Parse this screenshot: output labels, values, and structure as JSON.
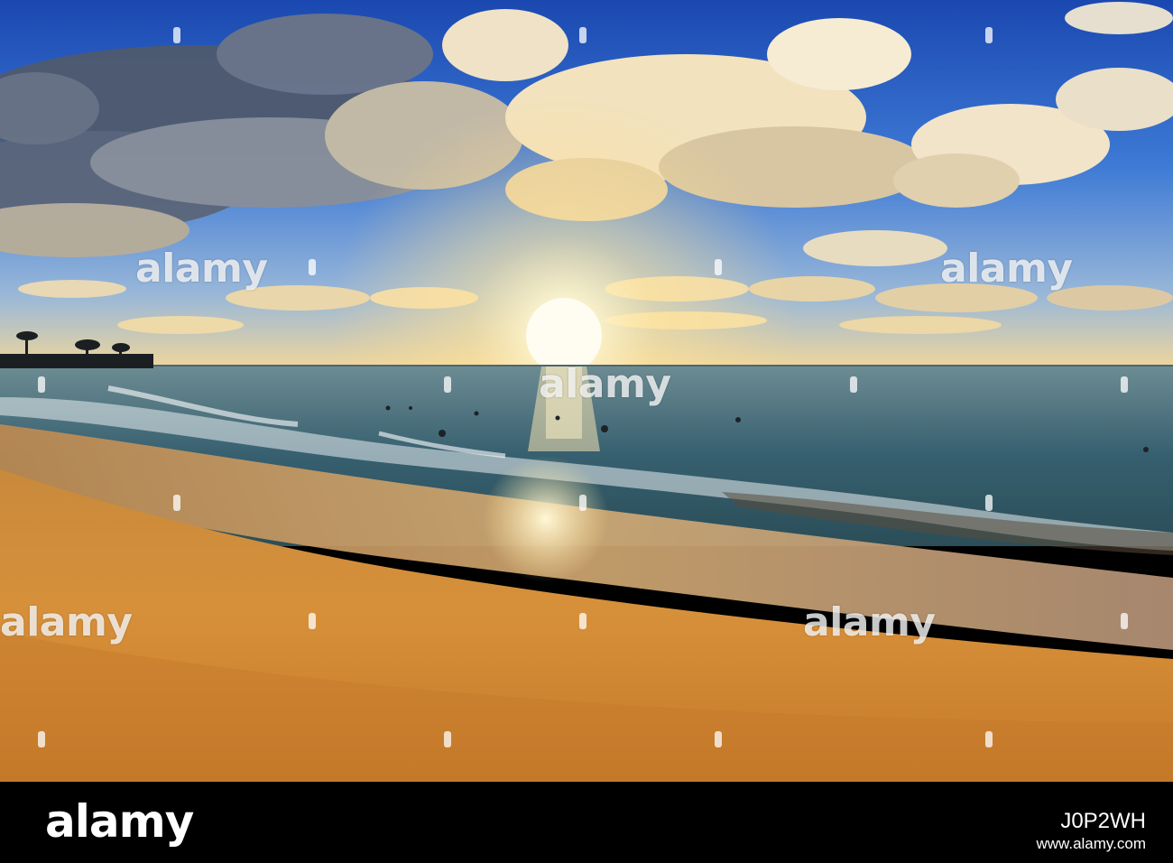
{
  "image": {
    "subject": "beach-sunset",
    "colors": {
      "sky_top": "#1e4fb8",
      "sky_mid": "#4b86e0",
      "horizon_glow": "#ffe7a0",
      "sun": "#fffbe6",
      "sea": "#3f6a7a",
      "sand": "#d08a2e",
      "sand_dark": "#a9621b"
    }
  },
  "watermark": {
    "text": "alamy"
  },
  "banner": {
    "brand": "alamy",
    "stock_id": "J0P2WH",
    "site": "www.alamy.com"
  }
}
